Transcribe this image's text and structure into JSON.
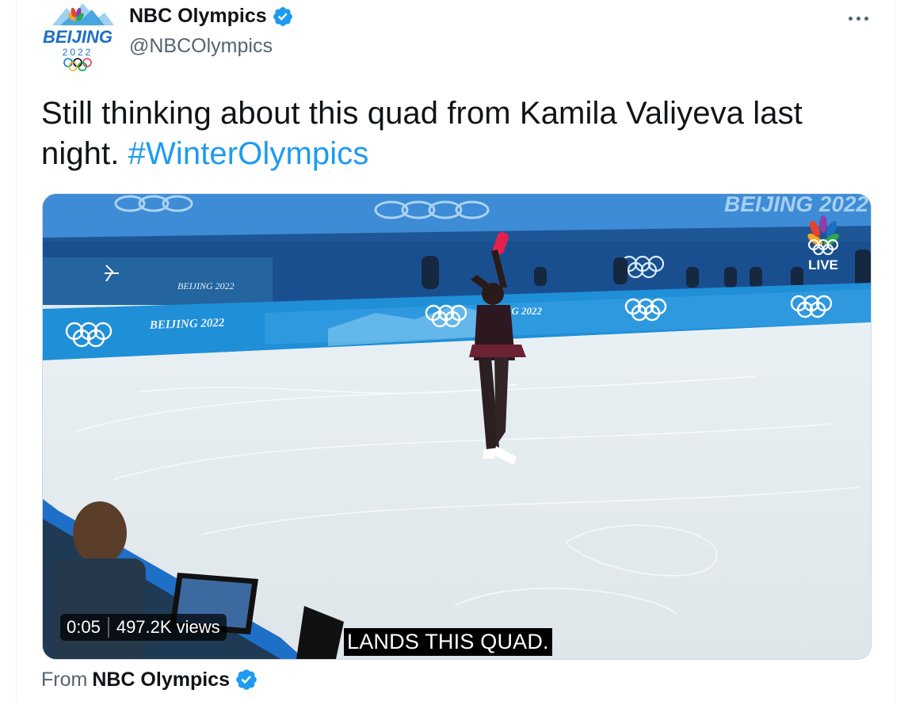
{
  "author": {
    "display_name": "NBC Olympics",
    "handle": "@NBCOlympics",
    "avatar": {
      "line1": "BEIJING",
      "line2": "2022"
    }
  },
  "tweet": {
    "text_before": "Still thinking about this quad from Kamila Valiyeva last night. ",
    "hashtag": "#WinterOlympics"
  },
  "media": {
    "video_time": "0:05",
    "views": "497.2K views",
    "caption": "LANDS THIS QUAD.",
    "live_label": "LIVE",
    "banner_text": "BEIJING 2022",
    "banner_text_partial": "NG 2022"
  },
  "footer": {
    "from_label": "From",
    "from_name": "NBC Olympics"
  },
  "colors": {
    "link_blue": "#1d9bf0",
    "verified_blue": "#1d9bf0",
    "muted_text": "#536471",
    "rink_blue": "#1f8fd8"
  },
  "icons": [
    "verified-badge-icon",
    "more-options-icon",
    "nbc-peacock-icon",
    "olympic-rings-icon"
  ]
}
